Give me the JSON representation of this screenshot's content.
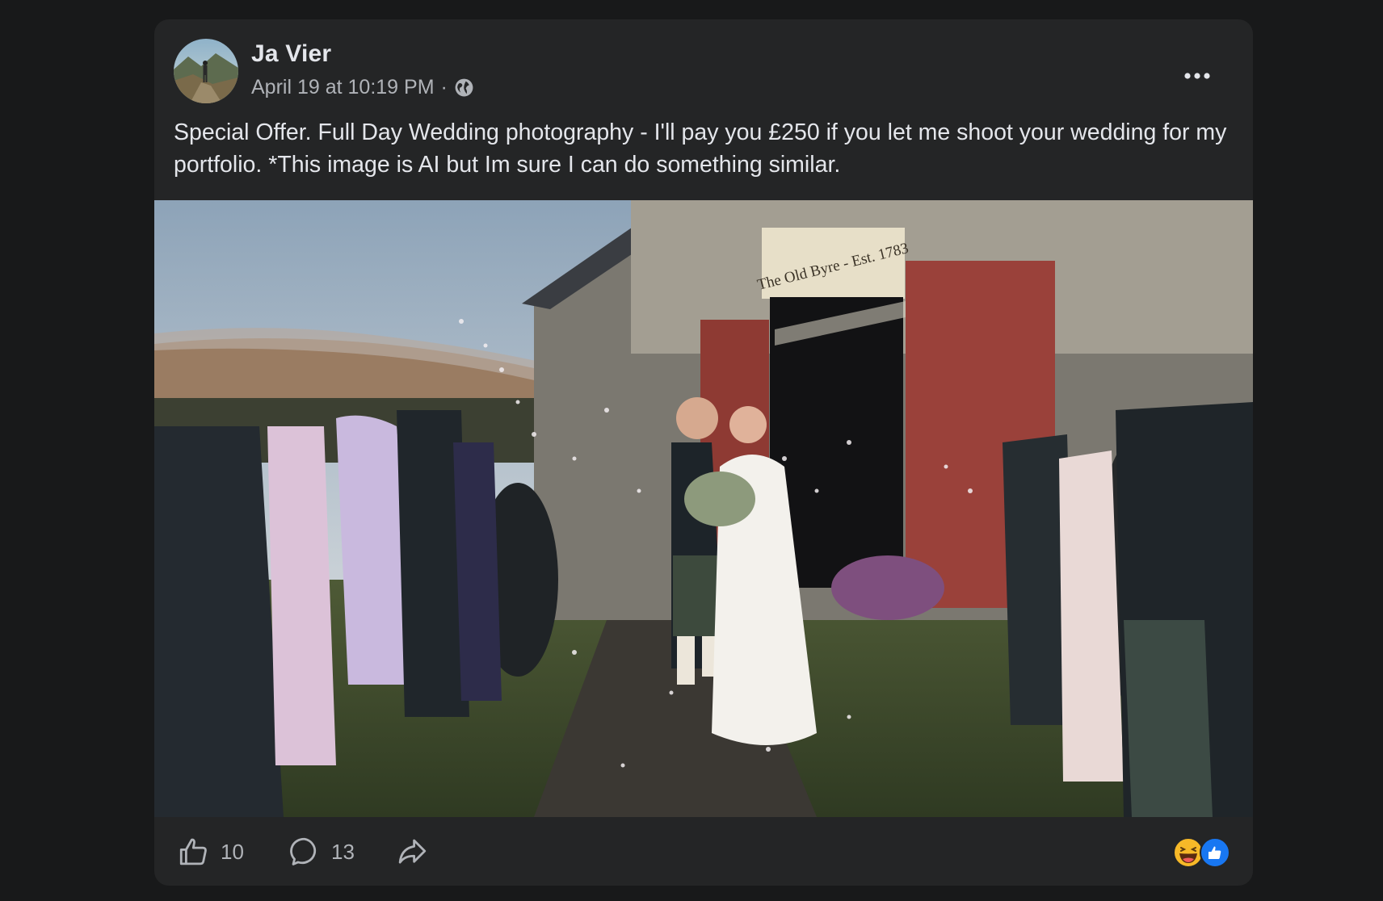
{
  "post": {
    "author": "Ja Vier",
    "timestamp": "April 19 at 10:19 PM",
    "separator": "·",
    "audience_icon": "globe-icon",
    "text": "Special Offer. Full Day Wedding photography - I'll pay you £250 if you let me shoot your wedding for my portfolio. *This image is AI but Im sure I can do something similar.",
    "photo": {
      "sign_text": "The Old Byre - Est. 1783"
    }
  },
  "actions": {
    "like_count": "10",
    "comment_count": "13",
    "like_icon": "thumbs-up-icon",
    "comment_icon": "comment-bubble-icon",
    "share_icon": "share-arrow-icon",
    "reactions": [
      "laugh-reaction-icon",
      "like-reaction-icon"
    ]
  },
  "colors": {
    "background": "#18191a",
    "card": "#242526",
    "primary_text": "#e4e6eb",
    "secondary_text": "#b0b3b8",
    "like_blue": "#1877f2",
    "haha_yellow": "#f7b928"
  }
}
